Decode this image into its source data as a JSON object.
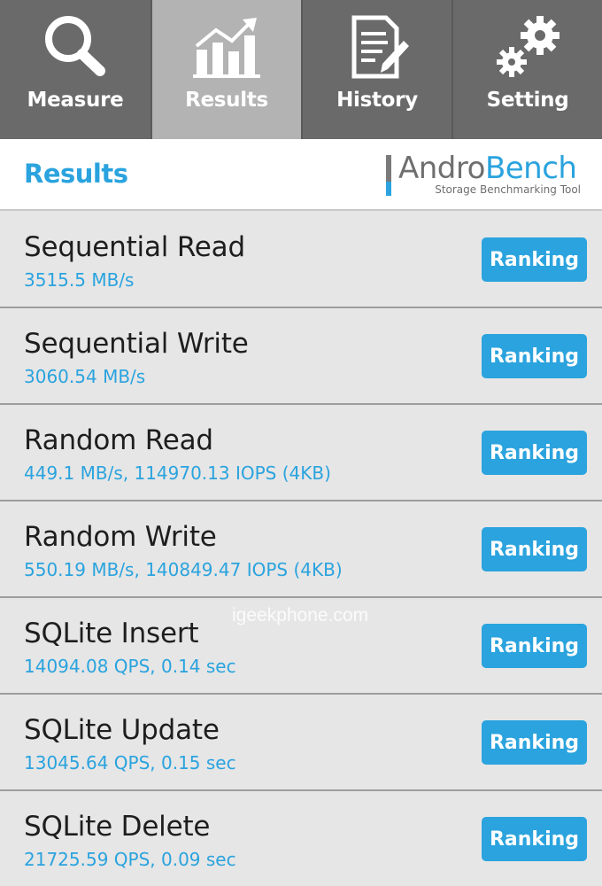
{
  "tabs": [
    {
      "label": "Measure",
      "icon": "search-icon",
      "active": false
    },
    {
      "label": "Results",
      "icon": "chart-icon",
      "active": true
    },
    {
      "label": "History",
      "icon": "document-icon",
      "active": false
    },
    {
      "label": "Setting",
      "icon": "gear-icon",
      "active": false
    }
  ],
  "header": {
    "title": "Results",
    "logo": {
      "name_part1": "Andro",
      "name_part2": "Bench",
      "tagline": "Storage Benchmarking Tool"
    }
  },
  "results": [
    {
      "name": "Sequential Read",
      "value": "3515.5 MB/s",
      "button": "Ranking"
    },
    {
      "name": "Sequential Write",
      "value": "3060.54 MB/s",
      "button": "Ranking"
    },
    {
      "name": "Random Read",
      "value": "449.1 MB/s, 114970.13 IOPS (4KB)",
      "button": "Ranking"
    },
    {
      "name": "Random Write",
      "value": "550.19 MB/s, 140849.47 IOPS (4KB)",
      "button": "Ranking"
    },
    {
      "name": "SQLite Insert",
      "value": "14094.08 QPS, 0.14 sec",
      "button": "Ranking"
    },
    {
      "name": "SQLite Update",
      "value": "13045.64 QPS, 0.15 sec",
      "button": "Ranking"
    },
    {
      "name": "SQLite Delete",
      "value": "21725.59 QPS, 0.09 sec",
      "button": "Ranking"
    }
  ],
  "watermark": "igeekphone.com",
  "colors": {
    "accent": "#2aa3de",
    "tab_bar": "#6a6a6a",
    "tab_active": "#b3b3b3",
    "row_bg": "#e6e6e6"
  }
}
